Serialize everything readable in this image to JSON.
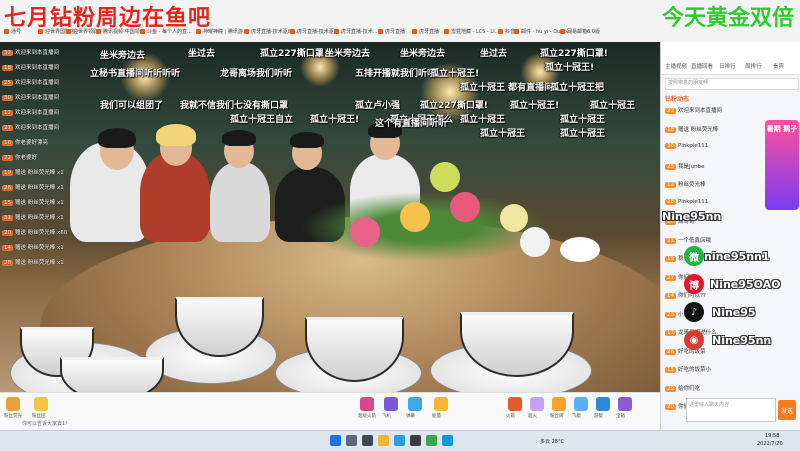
{
  "overlay": {
    "left_title": "七月钻粉周边在鱼吧",
    "right_title": "今天黄金双倍"
  },
  "bookmarks": [
    "通号",
    "迎世界国际店",
    "迎世界领取",
    "腾讯视频-中国领...",
    "斗鱼 - 每个人的直...",
    "神曜神瞳 | 腾讯游...",
    "虎牙直播-技术驱动...",
    "虎牙直播-技术驱动...",
    "虎牙直播-技术...",
    "虎牙直播",
    "虎牙直播",
    "雷霆地藏 - LCS - LI...",
    "抖音",
    "邮件 - hu yi - Outlo...",
    "网易邮箱6.0版"
  ],
  "danmu": [
    "坐米旁边去",
    "坐过去",
    "孤立227撕口罩!",
    "坐米旁边去",
    "坐米旁边去",
    "坐过去",
    "孤立227撕口罩!",
    "孤立十冠王!",
    "立秘书直播间听听听听",
    "龙哥离场我们听听",
    "五排开播就我们听听",
    "孤立十冠王!",
    "孤立十冠王 都有直播间",
    "孤立十冠王把",
    "我们可以组团了",
    "我就不信我们七没有撕口罩",
    "孤立卢小强",
    "孤立227撕口罩!",
    "孤立十冠王!",
    "孤立十冠王",
    "孤立十冠王自立",
    "孤立十冠王!",
    "孤立十冠王怎么",
    "孤立十冠王",
    "孤立十冠王",
    "这个有直播间听听",
    "孤立十冠王",
    "孤立十冠王"
  ],
  "left_chat": [
    {
      "level": "32",
      "text": "欢迎来到本直播间"
    },
    {
      "level": "18",
      "text": "欢迎来到本直播间"
    },
    {
      "level": "25",
      "text": "欢迎来到本直播间"
    },
    {
      "level": "30",
      "text": "欢迎来到本直播间"
    },
    {
      "level": "12",
      "text": "欢迎来到本直播间"
    },
    {
      "level": "27",
      "text": "欢迎来到本直播间"
    },
    {
      "level": "16",
      "text": "你老婆好漂亮"
    },
    {
      "level": "22",
      "text": "你老婆好"
    },
    {
      "level": "19",
      "text": "赠送 粉丝荧光棒 x1"
    },
    {
      "level": "26",
      "text": "赠送 粉丝荧光棒 x1"
    },
    {
      "level": "15",
      "text": "赠送 粉丝荧光棒 x1"
    },
    {
      "level": "31",
      "text": "赠送 粉丝荧光棒 x1"
    },
    {
      "level": "20",
      "text": "赠送 粉丝荧光棒 x60"
    },
    {
      "level": "14",
      "text": "赠送 粉丝荧光棒 x1"
    },
    {
      "level": "28",
      "text": "赠送 粉丝荧光棒 x1"
    }
  ],
  "sidebar": {
    "tabs": [
      "主播视频",
      "直播回看",
      "日排行",
      "周排行",
      "贵宾"
    ],
    "search_placeholder": "按照带着的朋友啊",
    "section_title": "钻粉动态",
    "messages": [
      {
        "level": "22",
        "text": "欢迎来到本直播间"
      },
      {
        "level": "18",
        "text": "赠送 粉丝荧光棒"
      },
      {
        "level": "30",
        "text": "Pinkpie111"
      },
      {
        "level": "25",
        "text": "我是Junbe"
      },
      {
        "level": "12",
        "text": "粉丝荧光棒"
      },
      {
        "level": "28",
        "text": "Pinkpie111"
      },
      {
        "level": "16",
        "text": "周哥哥"
      },
      {
        "level": "21",
        "text": "一个低鑫店哦"
      },
      {
        "level": "19",
        "text": "稳住老铁"
      },
      {
        "level": "27",
        "text": "你们可以"
      },
      {
        "level": "14",
        "text": "你们可以??"
      },
      {
        "level": "23",
        "text": "小鬼你们"
      },
      {
        "level": "17",
        "text": "龙哥只想说什么"
      },
      {
        "level": "26",
        "text": "好吃的饭菜"
      },
      {
        "level": "15",
        "text": "好吃的饭菜小"
      },
      {
        "level": "29",
        "text": "给你们吃"
      },
      {
        "level": "20",
        "text": "你们吃饭了吗子大"
      }
    ],
    "watermarks": [
      "Nine95nn",
      "nine95nn1",
      "Nine95OAO",
      "Nine95",
      "Nine95nn"
    ],
    "badge": "暑期 鹅子",
    "input_placeholder": "这里输入聊天内容",
    "send_label": "发送"
  },
  "bottom": {
    "gifts": [
      "粉丝荧光",
      "粉丝团",
      "超级火箭",
      "飞机",
      "弹幕",
      "能量",
      "火箭",
      "超火",
      "粉丝牌",
      "飞艇",
      "游艇",
      "宝箱"
    ],
    "status_text": "你可以告诉大家去1!"
  },
  "taskbar": {
    "time": "19:58",
    "date": "2022/7/20",
    "weather": "多云 28°C"
  }
}
